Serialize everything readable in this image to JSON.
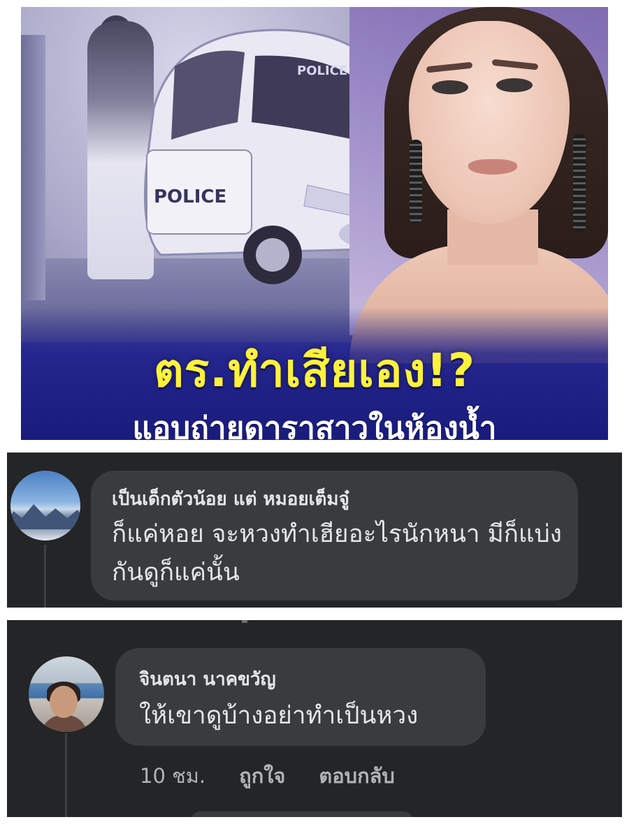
{
  "news_thumbnail": {
    "headline": "ตร.ทำเสียเอง!?",
    "subheadline": "แอบถ่ายดาราสาวในห้องน้ำ",
    "car_label": "POLICE",
    "car_label_front": "POLICE",
    "colors": {
      "headline": "#fff23a",
      "background_bottom": "#1a1c7c"
    }
  },
  "comments": [
    {
      "author": "เป็นเด็กตัวน้อย แต่ หมอยเต็มจู๋",
      "text": "ก็แค่หอย  จะหวงทำเฮียอะไรนักหนา  มีก็แบ่งกันดูก็แค่นั้น",
      "avatar_icon": "mountain-landscape-avatar"
    },
    {
      "author": "จินตนา นาคขวัญ",
      "text": "ให้เขาดูบ้างอย่าทำเป็นหวง",
      "avatar_icon": "person-photo-avatar",
      "time": "10 ชม.",
      "like_label": "ถูกใจ",
      "reply_label": "ตอบกลับ"
    }
  ],
  "theme": {
    "panel_bg": "#242526",
    "bubble_bg": "#3a3b3c",
    "text": "#e4e6eb",
    "muted": "#b0b3b8"
  }
}
